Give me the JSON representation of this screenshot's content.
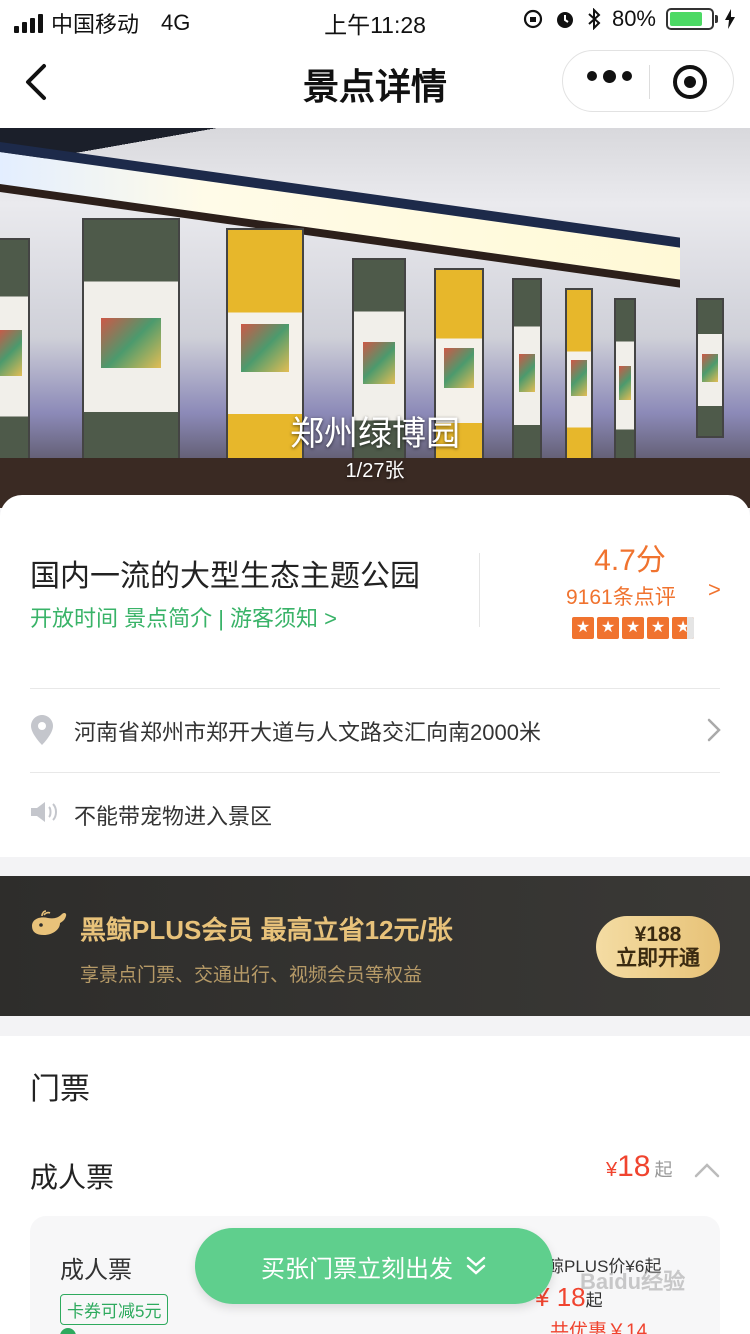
{
  "status_bar": {
    "carrier": "中国移动",
    "network": "4G",
    "time": "上午11:28",
    "battery": "80%",
    "battery_level": 0.8
  },
  "nav": {
    "title": "景点详情",
    "icons": [
      "back-arrow-icon",
      "more-dots-icon",
      "target-icon"
    ]
  },
  "gallery": {
    "caption": "郑州绿博园",
    "counter": "1/27张"
  },
  "info": {
    "headline": "国内一流的大型生态主题公园",
    "links": "开放时间 景点简介 | 游客须知 >",
    "score": "4.7分",
    "reviews": "9161条点评",
    "reviews_arrow": ">",
    "rating": 4.7,
    "address": "河南省郑州市郑开大道与人文路交汇向南2000米",
    "notice": "不能带宠物进入景区"
  },
  "plus": {
    "title": "黑鲸PLUS会员  最高立省12元/张",
    "subtitle": "享景点门票、交通出行、视频会员等权益",
    "price": "¥188",
    "button": "立即开通"
  },
  "tickets": {
    "section_title": "门票",
    "category": "成人票",
    "currency": "¥",
    "from_price": "18",
    "from_suffix": "起",
    "card": {
      "name": "成人票",
      "coupon": "卡券可减5元",
      "plus_price": "黑鲸PLUS价¥6起",
      "sale_currency": "¥",
      "sale_price": "18",
      "sale_suffix": "起",
      "discount": "共优惠￥14"
    }
  },
  "cta": {
    "label": "买张门票立刻出发"
  },
  "watermark": "Baidu经验",
  "colors": {
    "green": "#39b368",
    "orange": "#f0732f",
    "red": "#f0442f",
    "gold": "#e8c27a",
    "cta": "#5fcf8d"
  }
}
